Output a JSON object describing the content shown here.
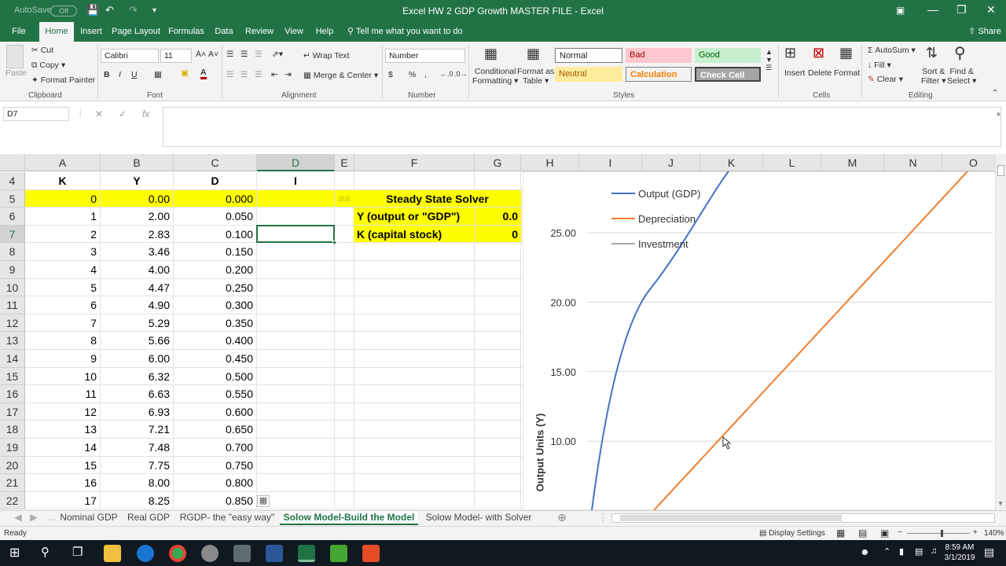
{
  "titlebar": {
    "autosave": "AutoSave",
    "toggle": "Off",
    "title": "Excel HW 2 GDP Growth MASTER FILE  -  Excel"
  },
  "tabs": [
    "File",
    "Home",
    "Insert",
    "Page Layout",
    "Formulas",
    "Data",
    "Review",
    "View",
    "Help"
  ],
  "tell_me": "Tell me what you want to do",
  "share": "Share",
  "ribbon": {
    "paste": "Paste",
    "cut": "Cut",
    "copy": "Copy",
    "format_painter": "Format Painter",
    "clipboard": "Clipboard",
    "font_name": "Calibri",
    "font_size": "11",
    "bold": "B",
    "italic": "I",
    "underline": "U",
    "font": "Font",
    "wrap_text": "Wrap Text",
    "merge_center": "Merge & Center",
    "alignment": "Alignment",
    "number_format": "Number",
    "dollar": "$",
    "percent": "%",
    "comma": ",",
    "number": "Number",
    "conditional": "Conditional",
    "conditional2": "Formatting",
    "format_as": "Format as",
    "format_as2": "Table",
    "styles": [
      "Normal",
      "Bad",
      "Good",
      "Neutral",
      "Calculation",
      "Check Cell"
    ],
    "styles_label": "Styles",
    "insert": "Insert",
    "delete": "Delete",
    "format": "Format",
    "cells": "Cells",
    "autosum": "AutoSum",
    "fill": "Fill",
    "clear": "Clear",
    "sort": "Sort &",
    "sort2": "Filter",
    "find": "Find &",
    "find2": "Select",
    "editing": "Editing"
  },
  "formula_bar": {
    "name_box": "D7",
    "fx": "fx",
    "value": ""
  },
  "columns": [
    "A",
    "B",
    "C",
    "D",
    "E",
    "F",
    "G",
    "H",
    "I",
    "J",
    "K",
    "L",
    "M",
    "N",
    "O"
  ],
  "rows": [
    {
      "n": "4",
      "k": "K",
      "y": "Y",
      "d": "D",
      "i": "I"
    },
    {
      "n": "5",
      "k": "0",
      "y": "0.00",
      "d": "0.000",
      "i": "",
      "e": "##"
    },
    {
      "n": "6",
      "k": "1",
      "y": "2.00",
      "d": "0.050",
      "i": ""
    },
    {
      "n": "7",
      "k": "2",
      "y": "2.83",
      "d": "0.100",
      "i": ""
    },
    {
      "n": "8",
      "k": "3",
      "y": "3.46",
      "d": "0.150",
      "i": ""
    },
    {
      "n": "9",
      "k": "4",
      "y": "4.00",
      "d": "0.200",
      "i": ""
    },
    {
      "n": "10",
      "k": "5",
      "y": "4.47",
      "d": "0.250",
      "i": ""
    },
    {
      "n": "11",
      "k": "6",
      "y": "4.90",
      "d": "0.300",
      "i": ""
    },
    {
      "n": "12",
      "k": "7",
      "y": "5.29",
      "d": "0.350",
      "i": ""
    },
    {
      "n": "13",
      "k": "8",
      "y": "5.66",
      "d": "0.400",
      "i": ""
    },
    {
      "n": "14",
      "k": "9",
      "y": "6.00",
      "d": "0.450",
      "i": ""
    },
    {
      "n": "15",
      "k": "10",
      "y": "6.32",
      "d": "0.500",
      "i": ""
    },
    {
      "n": "16",
      "k": "11",
      "y": "6.63",
      "d": "0.550",
      "i": ""
    },
    {
      "n": "17",
      "k": "12",
      "y": "6.93",
      "d": "0.600",
      "i": ""
    },
    {
      "n": "18",
      "k": "13",
      "y": "7.21",
      "d": "0.650",
      "i": ""
    },
    {
      "n": "19",
      "k": "14",
      "y": "7.48",
      "d": "0.700",
      "i": ""
    },
    {
      "n": "20",
      "k": "15",
      "y": "7.75",
      "d": "0.750",
      "i": ""
    },
    {
      "n": "21",
      "k": "16",
      "y": "8.00",
      "d": "0.800",
      "i": ""
    },
    {
      "n": "22",
      "k": "17",
      "y": "8.25",
      "d": "0.850",
      "i": ""
    }
  ],
  "solver": {
    "title": "Steady State Solver",
    "y_label": "Y (output or \"GDP\")",
    "y_value": "0.0",
    "k_label": "K (capital stock)",
    "k_value": "0"
  },
  "chart": {
    "ylabel": "Output Units (Y)",
    "yticks": [
      "25.00",
      "20.00",
      "15.00",
      "10.00"
    ],
    "legend": [
      {
        "name": "Output (GDP)",
        "color": "#4472c4"
      },
      {
        "name": "Depreciation",
        "color": "#ed7d31"
      },
      {
        "name": "Investment",
        "color": "#a5a5a5"
      }
    ]
  },
  "sheets": [
    "Nominal GDP",
    "Real GDP",
    "RGDP- the \"easy way\"",
    "Solow Model-Build the Model",
    "Solow Model- with Solver"
  ],
  "status": {
    "ready": "Ready",
    "display_settings": "Display Settings",
    "zoom": "140%"
  },
  "taskbar": {
    "time": "8:59 AM",
    "date": "3/1/2019"
  }
}
